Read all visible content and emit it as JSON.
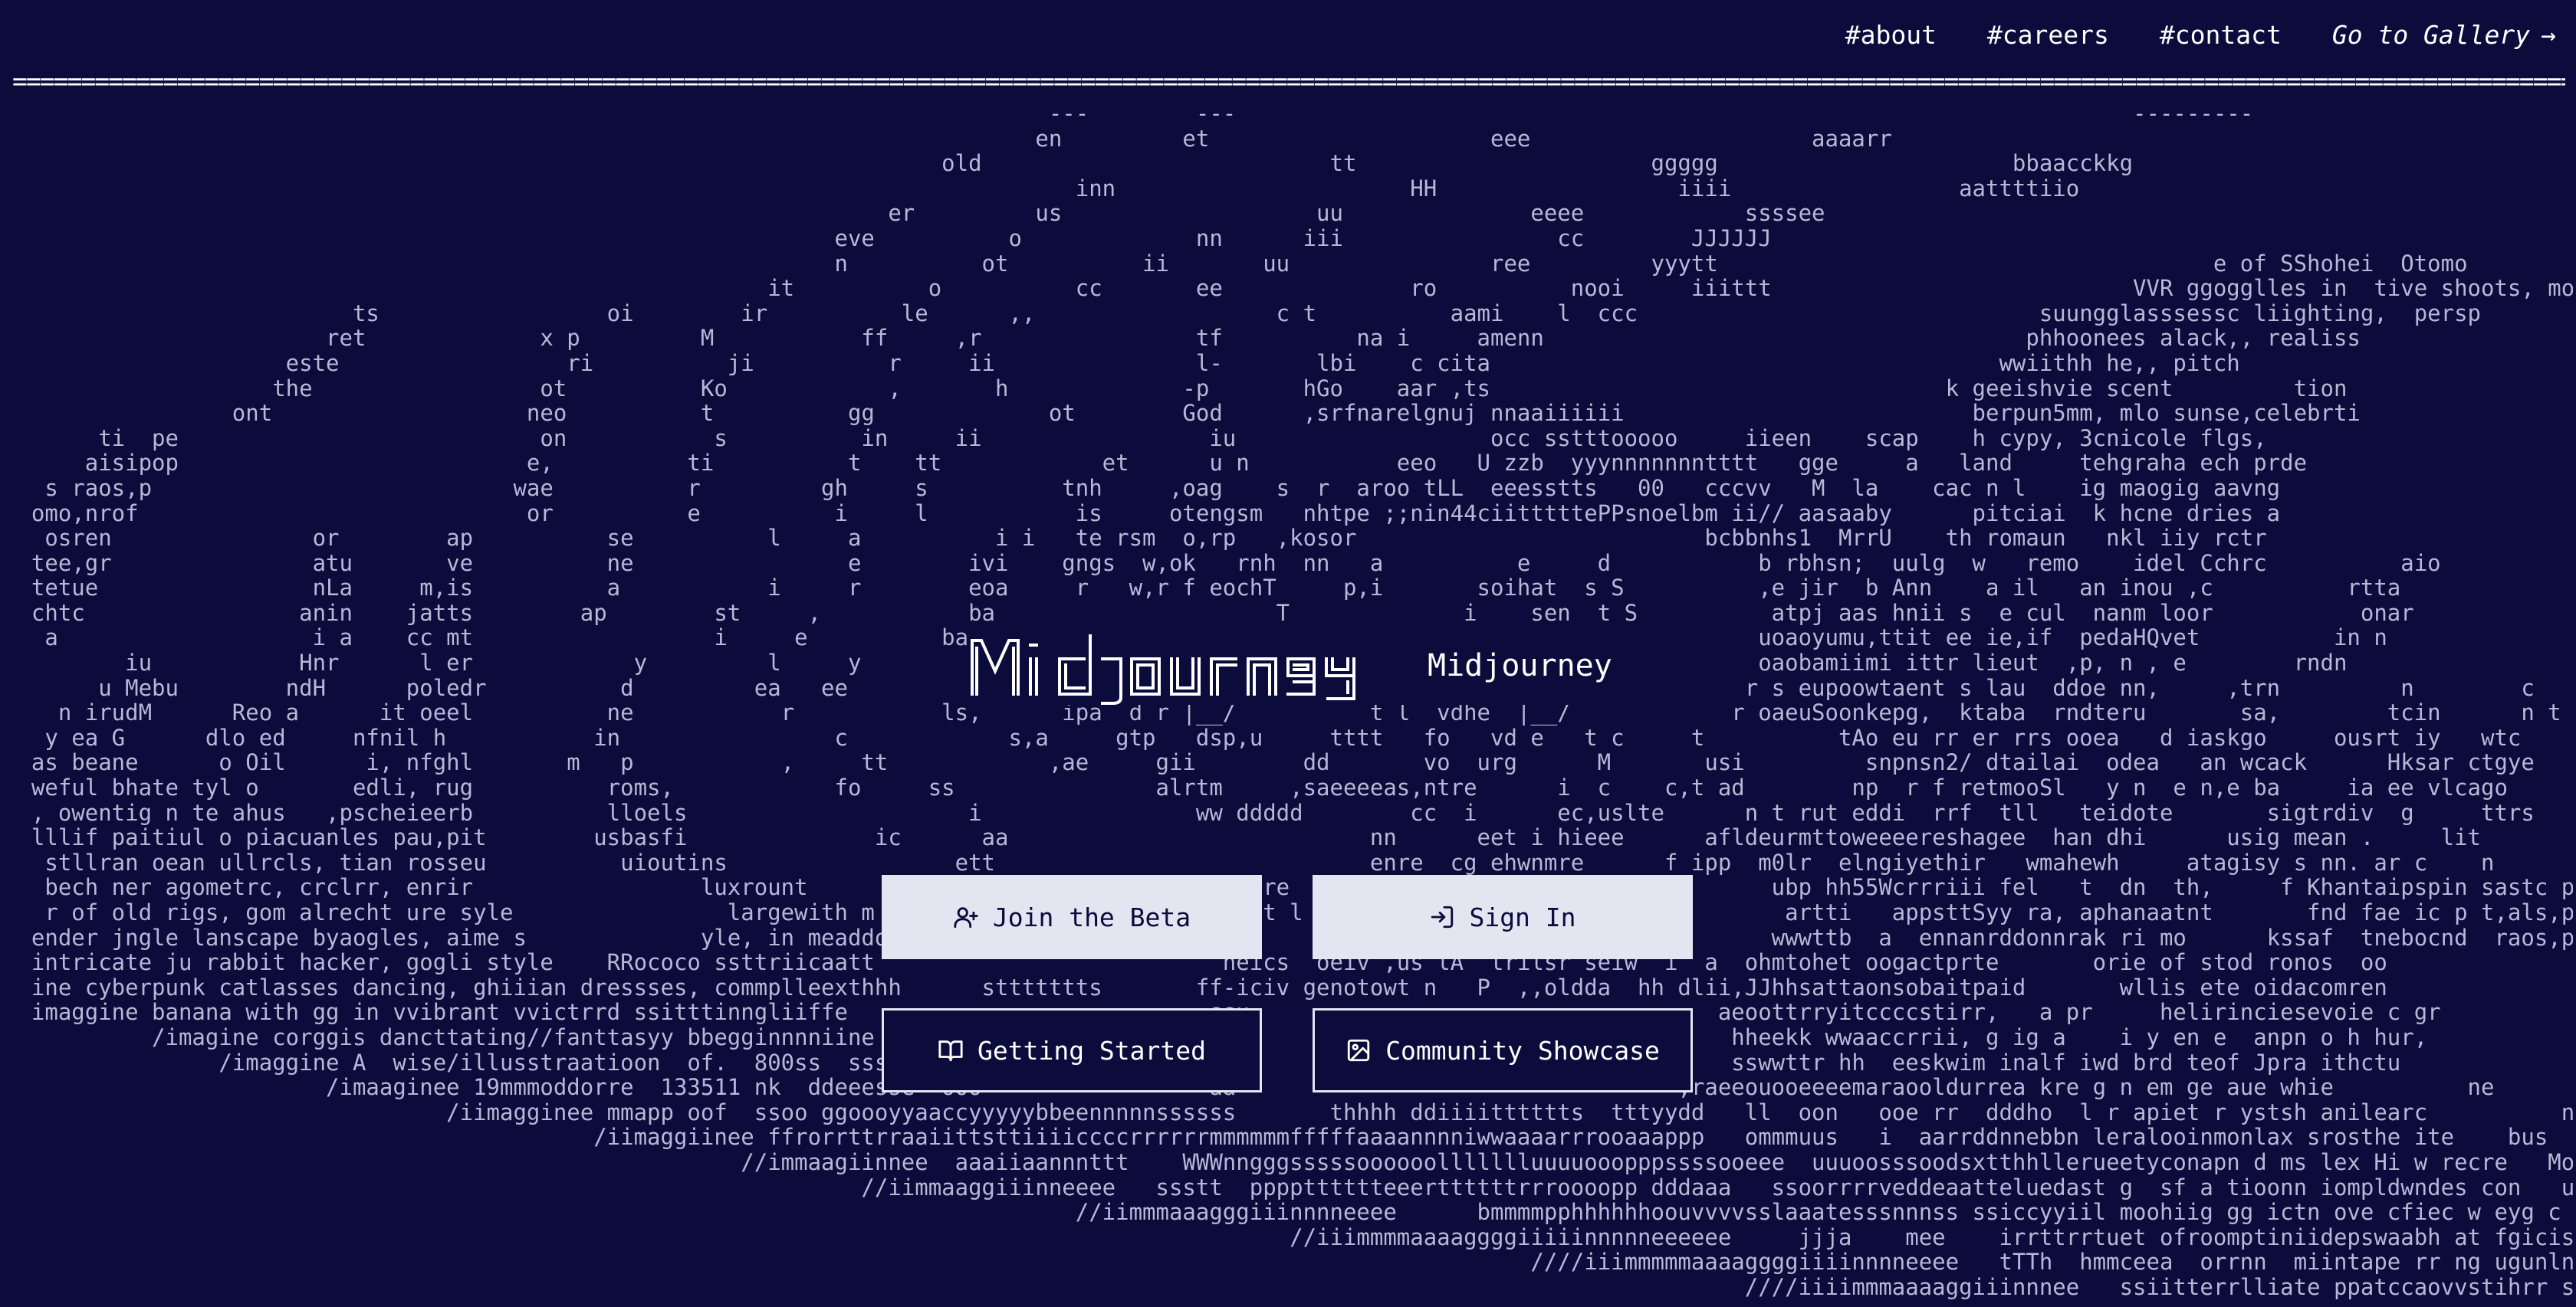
{
  "nav": {
    "about": "#about",
    "careers": "#careers",
    "contact": "#contact",
    "gallery": "Go to Gallery",
    "gallery_arrow": "→"
  },
  "rule": "=======================================================================================================================================================================================================",
  "logo_text": "Midjourney",
  "buttons": {
    "join": "Join the Beta",
    "signin": "Sign In",
    "started": "Getting Started",
    "showcase": "Community Showcase"
  },
  "icons": {
    "join": "user-plus-icon",
    "signin": "sign-in-icon",
    "started": "book-icon",
    "showcase": "image-icon",
    "gallery": "arrow-right-icon"
  },
  "colors": {
    "background": "#0b0b3c",
    "text": "#b9bcd8",
    "button_light": "#e3e5f1"
  },
  "ascii_art": "                                                                              ---        ---                                                                   ---------\n                                                                             en         et                     eee                     aaaarr\n                                                                      old                          tt                      ggggg                      bbaacckkg\n                                                                                inn                      HH                  iiii                 aattttiio\n                                                                  er         us                   uu              eeee            ssssee\n                                                              eve          o             nn      iii                cc        JJJJJJ\n                                                              n          ot          ii       uu               ree         yyytt                                     e of SShohei  Otomo\n                                                         it          o          cc       ee              ro          nooi     iiittt                           VVR ggogglles in  tive shoots, moody atmoo\n                          ts                 oi        ir          le      ,,                  c t          aami    l  ccc                              suungglasssessc liighting,  persp\n                        ret             x p         M           ff     ,r                tf          na i     amenn                                    phhoonees alack,, realiss\n                     este                 ri          ji          r     ii               l-       lbi    c cita                                      wwiithh he,, pitch\n                    the                 ot          Ko            ,       h             -p       hGo    aar ,ts                                  k geeishvie scent         tion\n                 ont                   neo          t          gg             ot        God      ,srfnarelgnuj nnaaiiiiii                          berpun5mm, mlo sunse,celebrti\n       ti  pe                           on           s          in     ii                 iu                   occ sstttooooo     iieen    scap    h cypy, 3cnicole flgs,\n      aisipop                          e,          ti          t    tt            et      u n           eeo   U zzb  yyynnnnnnntttt   gge     a   land     tehgraha ech prde\n   s raos,p                           wae          r         gh     s          tnh     ,oag    s  r  aroo tLL  eeesstts   00   cccvv   M  la    cac n l    ig maogig aavng\n  omo,nrof                             or          e          i     l           is     otengsm   nhtpe ;;nin44ciitttttePPsnoelbm ii// aasaaby      pitciai  k hcne dries a\n   osren               or        ap          se          l     a          i i   te rsm  o,rp   ,kosor                          bcbbnhs1  MrrU    th romaun   nkl iiy rctr\n  tee,gr               atu       ve          ne                e        ivi    gngs  w,ok   rnh  nn   a          e     d           b rbhsn;  uulg  w   remo    idel Cchrc          aio\n  tetue                nLa     m,is          a           i     r        eoa     r   w,r f eochT     p,i       soihat  s S          ,e jir  b Ann    a il   an inou ,c          rtta\n  chtc                anin    jatts        ap        st     ,           ba                     T             i    sen  t S          atpj aas hnii s  e cul  nanm loor           onar\n   a                   i a    cc mt                  i     e          ban                                                          uoaoyumu,ttit ee ie,if  pedaHQvet          in n\n         iu           Hnr      l er            y         l     y         aec                                                       oaobamiimi ittr lieut  ,p, n , e        rndn\n       u Mebu        ndH      poledr          d         ea   ee         aac                                                       r s eupoowtaent s lau  ddoe nn,     ,trn         n        c\n    n irudM      Reo a      it oeel          ne           r           ls,      ipa  d r |__/          t l  vdhe  |__/            r oaeuSoonkepg,  ktaba  rndteru       sa,        tcin      n t\n   y ea G      dlo ed     nfnil h           in                c            s,a     gtp   dsp,u     tttt   fo   vd e   t c     t          tAo eu rr er rrs ooea   d iaskgo     ousrt iy   wtc      aoud\n  as beane      o Oil      i, nfghl       m   p           ,     tt            ,ae     gii        dd       vo  urg      M       usi         snpnsn2/ dtailai  odea   an wcack      Hksar ctgye       tl a\n  weful bhate tyl o       edli, rug          roms,            fo     ss               alrtm     ,saeeeeas,ntre      i  c    c,t ad        np  r f retmooSl   y n  e n,e ba     ia ee vlcago      sbt\n  , owentig n te ahus   ,pscheieerb          lloels                     i                ww ddddd        cc  i      ec,uslte      n t rut eddi  rrf  tll   teidote       sigtrdiv  g     ttrs\n  lllif paitiul o piacuanles pau,pit        usbasfi              ic      aa                           nn      eet i hieee      afldeurmttoweeeereshagee  han dhi      usig mean .     lit\n   stllran oean ullrcls, tian rosseu          uioutins                 ett                            enre  cg ehwnmre      f ipp  m0lr  elngiyethir   wmahewh     atagisy s nn. ar c    n\n   bech ner agometrc, crclrr, enrir                 luxrount                                 rre                                    ubp hh55Wcrrriii fel   t  dn  th,     f Khantaipspin sastc pl\n   r of old rigs, gom alrecht ure syle                largewith m                            it l                                    artti   appsttSyy ra, aphanaatnt       fnd fae ic p t,als,pep\n  ender jngle lanscape byaogles, aime s             yle, in meaddow                                                                 wwwttb  a  ennanrddonnrak ri mo      kssaf  tnebocnd  raos,p\n  intricate ju rabbit hacker, gogli style    RRococo ssttriicaatt                          neics  oeiv ,us lA  trilsr seiw  i  a  ohmtohet oogactprte       orie of stod ronos  oo\n  ine cyberpunk catlasses dancing, ghiiian dressses, commplleexthhh      sttttttts       ff-iciv genotowt n   P  ,,oldda  hh dlii,JJhhsattaonsobaitpaid       wllis ete oidacomren\n  imaggine banana with gg in vvibrant vvictrrd ssitttinngliiffe                           ssu                                   aeoottrryitccccstirr,   a pr     helirinciesevoie c gr\n           /imagine corggis dancttating//fanttasyy bbegginnnniine                          llb                                   hheekk wwaaccrrii, g ig a    i y en e  anpn o h hur,\n                /imaggine A  wise/illusstraatioon  of.  800ss  sss                         ese                                   sswwttr hh  eeskwim inalf iwd brd teof Jpra ithctu\n                        /imaaginee 19mmmoddorre  133511 nk  ddeeesse  ooo                 aa                                 ,raeeouooeeeemaraooldurrea kre g n em ge aue whie          ne\n                                 /iimagginee mmapp oof  ssoo ggoooyyaaccyyyyybbeennnnnssssss       thhhh ddiiiitttttts  tttyydd   ll  oon   ooe rr  dddho  l r apiet r ystsh anilearc          ndHe\n                                            /iimaggiinee ffrorrttrraaiittsttiiiiccccrrrrrrmmmmmmfffffaaaannnniwwaaaarrrooaaappp   ommmuus   i  aarrddnnebbn leralooinmonlax srosthe ite    bus    o an\n                                                       //immaagiinnee  aaaiiaannnttt    WWWnngggsssssoooooollllllluuuuooopppssssooeee  uuuoosssoodsxtthhllerueetyconapn d ms lex Hi w recre   Mobi   Reon   i\n                                                                //iimmaaggiiinneeee   ssstt  pppptttttteeerttttttrrroooopp dddaaa   ssoorrrrveddeaatteluedast g  sf a tioonn iompldwndes con   udM    on    c,\n                                                                                //iimmmaaagggiiinnnneeee      bmmmmpphhhhhhoouvvvvsslaaatesssnnnss ssiccyyiil moohiig gg ictn ove cfiec w eyg c   iru    dil    elic\n                                                                                                //iiimmmmaaaaggggiiiiinnnnneeeeee     jjja    mee    irrttrrtuet ofroomptiniidepswaabh at fgicis ing     Gi   of O   ycediter\n                                                                                                                  ////iiimmmmmaaaaggggiiiinnnneeee   tTTh  hmmceea  orrnn  miintape rr ng ugunln mh, glont Jeae    le      pyu, i\n                                                                                                                                  ////iiiimmmaaaaggiiinnnee   ssiitterrlliate ppatccaovvstihrr sudeancts  Monby nce sty's le, sea,"
}
